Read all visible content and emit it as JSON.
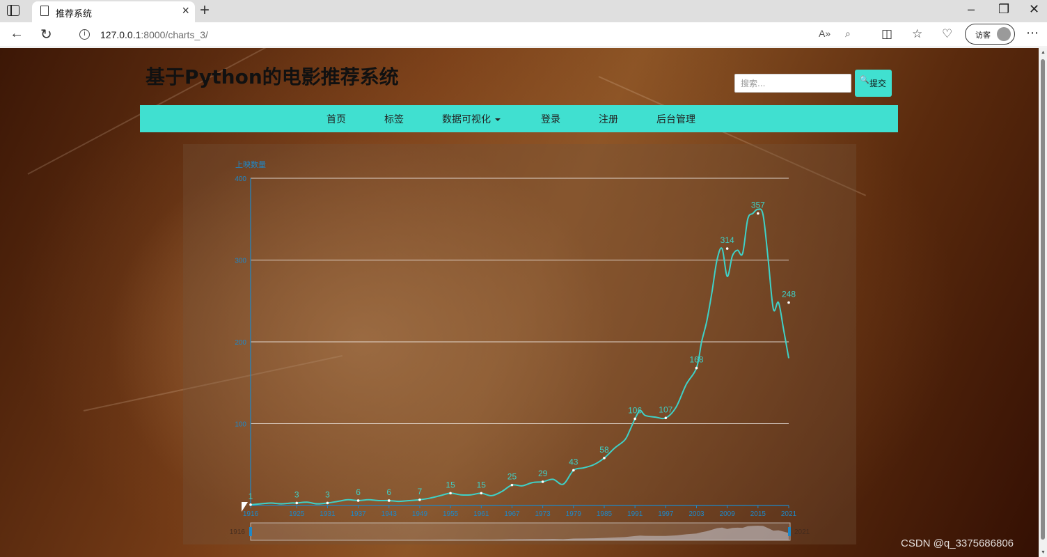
{
  "browser": {
    "tab_title": "推荐系统",
    "url_host": "127.0.0.1",
    "url_rest": ":8000/charts_3/",
    "profile_label": "访客"
  },
  "site": {
    "title": "基于Python的电影推荐系统",
    "search_placeholder": "搜索...",
    "submit_label": "提交",
    "nav": [
      {
        "label": "首页"
      },
      {
        "label": "标签"
      },
      {
        "label": "数据可视化"
      },
      {
        "label": "登录"
      },
      {
        "label": "注册"
      },
      {
        "label": "后台管理"
      }
    ]
  },
  "watermark": "CSDN @q_3375686806",
  "colors": {
    "accent": "#40e0d0",
    "line": "#3fd1c7",
    "axis": "#1e88c8"
  },
  "chart_data": {
    "type": "line",
    "ylabel": "上映数量",
    "ylim": [
      0,
      400
    ],
    "yticks": [
      100,
      200,
      300,
      400
    ],
    "x_tick_labels": [
      "1916",
      "1925",
      "1931",
      "1937",
      "1943",
      "1949",
      "1955",
      "1961",
      "1967",
      "1973",
      "1979",
      "1985",
      "1991",
      "1997",
      "2003",
      "2009",
      "2015",
      "2021"
    ],
    "x_start": 1916,
    "x_end": 2021,
    "series": [
      {
        "x": [
          1916,
          1918,
          1920,
          1922,
          1924,
          1925,
          1927,
          1929,
          1931,
          1933,
          1935,
          1937,
          1939,
          1941,
          1943,
          1945,
          1947,
          1949,
          1951,
          1953,
          1955,
          1957,
          1959,
          1961,
          1963,
          1965,
          1967,
          1969,
          1971,
          1973,
          1975,
          1977,
          1979,
          1981,
          1983,
          1985,
          1987,
          1989,
          1990,
          1991,
          1992,
          1993,
          1995,
          1997,
          1999,
          2001,
          2003,
          2004,
          2005,
          2006,
          2007,
          2008,
          2009,
          2010,
          2011,
          2012,
          2013,
          2014,
          2015,
          2016,
          2017,
          2018,
          2019,
          2020,
          2021
        ],
        "y": [
          1,
          2,
          3,
          2,
          3,
          3,
          4,
          2,
          3,
          5,
          7,
          6,
          7,
          6,
          6,
          5,
          6,
          7,
          9,
          12,
          15,
          13,
          13,
          15,
          12,
          17,
          25,
          24,
          28,
          29,
          32,
          26,
          43,
          46,
          50,
          58,
          70,
          80,
          92,
          106,
          116,
          110,
          108,
          107,
          120,
          148,
          168,
          200,
          225,
          260,
          300,
          314,
          280,
          305,
          312,
          308,
          350,
          357,
          362,
          355,
          300,
          240,
          248,
          215,
          180
        ]
      }
    ],
    "point_labels": [
      {
        "x": 1916,
        "y": 1,
        "label": "1"
      },
      {
        "x": 1925,
        "y": 3,
        "label": "3"
      },
      {
        "x": 1931,
        "y": 3,
        "label": "3"
      },
      {
        "x": 1937,
        "y": 6,
        "label": "6"
      },
      {
        "x": 1943,
        "y": 6,
        "label": "6"
      },
      {
        "x": 1949,
        "y": 7,
        "label": "7"
      },
      {
        "x": 1955,
        "y": 15,
        "label": "15"
      },
      {
        "x": 1961,
        "y": 15,
        "label": "15"
      },
      {
        "x": 1967,
        "y": 25,
        "label": "25"
      },
      {
        "x": 1973,
        "y": 29,
        "label": "29"
      },
      {
        "x": 1979,
        "y": 43,
        "label": "43"
      },
      {
        "x": 1985,
        "y": 58,
        "label": "58"
      },
      {
        "x": 1991,
        "y": 106,
        "label": "106"
      },
      {
        "x": 1997,
        "y": 107,
        "label": "107"
      },
      {
        "x": 2003,
        "y": 168,
        "label": "168"
      },
      {
        "x": 2009,
        "y": 314,
        "label": "314"
      },
      {
        "x": 2015,
        "y": 357,
        "label": "357"
      },
      {
        "x": 2021,
        "y": 248,
        "label": "248"
      }
    ],
    "datazoom": {
      "start_label": "1916",
      "end_label": "2021"
    },
    "grid": true
  }
}
